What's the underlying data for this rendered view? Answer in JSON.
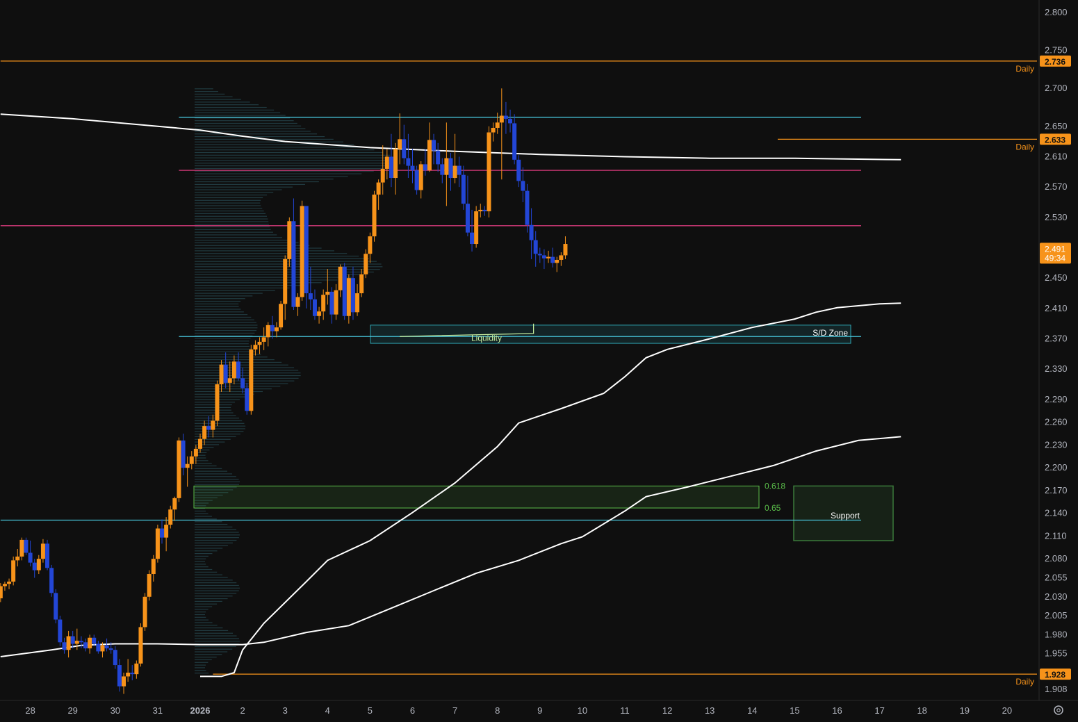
{
  "colors": {
    "background": "#0f0f0f",
    "up": "#f7931a",
    "down": "#2346d6",
    "cyan": "#47c3d9",
    "magenta": "#d63a7a",
    "orange_line": "#f7931a",
    "white_line": "#ffffff",
    "fib_green": "#5bbf4a",
    "support_box": "#3b7a3b",
    "sd_zone": "#2ea3b0",
    "liquidity": "#c9f0a0",
    "axis_text": "#b2b5be"
  },
  "chart_data": {
    "type": "candlestick",
    "title": "",
    "ylim": [
      1.9,
      2.82
    ],
    "y_ticks": [
      "2.800",
      "2.750",
      "2.700",
      "2.650",
      "2.610",
      "2.570",
      "2.530",
      "2.450",
      "2.410",
      "2.370",
      "2.330",
      "2.290",
      "2.260",
      "2.230",
      "2.200",
      "2.170",
      "2.140",
      "2.110",
      "2.080",
      "2.055",
      "2.030",
      "2.005",
      "1.980",
      "1.955",
      "1.908"
    ],
    "x_ticks": [
      "28",
      "29",
      "30",
      "31",
      "2026",
      "2",
      "3",
      "4",
      "5",
      "6",
      "7",
      "8",
      "9",
      "10",
      "11",
      "12",
      "13",
      "14",
      "15",
      "16",
      "17",
      "18",
      "19",
      "20"
    ],
    "price_badges": [
      {
        "value": 2.736,
        "label": "2.736",
        "tag": "Daily"
      },
      {
        "value": 2.633,
        "label": "2.633",
        "tag": "Daily"
      },
      {
        "value": 1.928,
        "label": "1.928",
        "tag": "Daily"
      }
    ],
    "current_price": {
      "value": 2.491,
      "label": "2.491",
      "countdown": "49:34"
    },
    "horizontal_lines": [
      {
        "value": 2.736,
        "color": "orange",
        "start_day": -4.7
      },
      {
        "value": 2.633,
        "color": "orange",
        "start_day": 13.6
      },
      {
        "value": 1.928,
        "color": "orange",
        "start_day": 0.3
      },
      {
        "value": 2.662,
        "color": "cyan",
        "start_day": -0.5
      },
      {
        "value": 2.592,
        "color": "magenta",
        "start_day": -0.5
      },
      {
        "value": 2.519,
        "color": "magenta",
        "start_day": -4.7
      },
      {
        "value": 2.373,
        "color": "cyan",
        "start_day": -0.5
      },
      {
        "value": 2.131,
        "color": "cyan",
        "start_day": -4.7
      }
    ],
    "fib_zone": {
      "top": 2.176,
      "bottom": 2.147,
      "labels": [
        "0.618",
        "0.65"
      ]
    },
    "sd_zone": {
      "top": 2.388,
      "bottom": 2.364,
      "label": "S/D Zone"
    },
    "liquidity": {
      "value": 2.373,
      "label": "Liquidity"
    },
    "support_box": {
      "top": 2.176,
      "bottom": 2.104,
      "label": "Support"
    },
    "moving_averages": [
      {
        "name": "ma_long",
        "points": [
          [
            -4.7,
            2.666
          ],
          [
            -3.0,
            2.66
          ],
          [
            -1.0,
            2.65
          ],
          [
            0,
            2.645
          ],
          [
            1,
            2.637
          ],
          [
            2,
            2.63
          ],
          [
            4,
            2.622
          ],
          [
            6,
            2.617
          ],
          [
            8,
            2.613
          ],
          [
            10,
            2.61
          ],
          [
            12,
            2.608
          ],
          [
            14,
            2.608
          ],
          [
            16.5,
            2.606
          ]
        ]
      },
      {
        "name": "ma_mid",
        "points": [
          [
            -4.7,
            1.951
          ],
          [
            -3.5,
            1.96
          ],
          [
            -2.8,
            1.966
          ],
          [
            -2.0,
            1.968
          ],
          [
            -1.0,
            1.968
          ],
          [
            0,
            1.967
          ],
          [
            1,
            1.967
          ],
          [
            1.5,
            1.97
          ],
          [
            2.5,
            1.983
          ],
          [
            3.5,
            1.992
          ],
          [
            4.5,
            2.015
          ],
          [
            5.5,
            2.038
          ],
          [
            6.5,
            2.061
          ],
          [
            7.5,
            2.078
          ],
          [
            8.5,
            2.1
          ],
          [
            9,
            2.109
          ],
          [
            10,
            2.143
          ],
          [
            10.5,
            2.162
          ],
          [
            11.5,
            2.175
          ],
          [
            12.5,
            2.189
          ],
          [
            13.5,
            2.203
          ],
          [
            14.5,
            2.222
          ],
          [
            15.5,
            2.236
          ],
          [
            16.5,
            2.241
          ]
        ]
      },
      {
        "name": "ma_short",
        "points": [
          [
            0,
            1.925
          ],
          [
            0.5,
            1.925
          ],
          [
            0.8,
            1.93
          ],
          [
            1.0,
            1.96
          ],
          [
            1.5,
            1.995
          ],
          [
            2.5,
            2.05
          ],
          [
            3,
            2.078
          ],
          [
            4,
            2.104
          ],
          [
            5,
            2.141
          ],
          [
            6,
            2.18
          ],
          [
            7,
            2.228
          ],
          [
            7.5,
            2.259
          ],
          [
            8.5,
            2.278
          ],
          [
            9.5,
            2.298
          ],
          [
            10,
            2.32
          ],
          [
            10.5,
            2.345
          ],
          [
            11,
            2.356
          ],
          [
            12,
            2.37
          ],
          [
            13,
            2.385
          ],
          [
            14,
            2.396
          ],
          [
            14.5,
            2.405
          ],
          [
            15,
            2.411
          ],
          [
            16,
            2.416
          ],
          [
            16.5,
            2.417
          ]
        ]
      }
    ],
    "candles": [
      [
        -4.7,
        2.028,
        2.048,
        2.023,
        2.044
      ],
      [
        -4.6,
        2.044,
        2.05,
        2.038,
        2.047
      ],
      [
        -4.5,
        2.047,
        2.054,
        2.04,
        2.05
      ],
      [
        -4.4,
        2.05,
        2.083,
        2.045,
        2.078
      ],
      [
        -4.3,
        2.078,
        2.093,
        2.07,
        2.083
      ],
      [
        -4.2,
        2.083,
        2.108,
        2.078,
        2.105
      ],
      [
        -4.1,
        2.105,
        2.108,
        2.085,
        2.088
      ],
      [
        -4.0,
        2.088,
        2.104,
        2.07,
        2.075
      ],
      [
        -3.9,
        2.075,
        2.08,
        2.055,
        2.065
      ],
      [
        -3.8,
        2.065,
        2.085,
        2.06,
        2.08
      ],
      [
        -3.7,
        2.08,
        2.106,
        2.075,
        2.1
      ],
      [
        -3.6,
        2.1,
        2.105,
        2.065,
        2.068
      ],
      [
        -3.5,
        2.068,
        2.072,
        2.03,
        2.035
      ],
      [
        -3.4,
        2.035,
        2.04,
        1.995,
        2.0
      ],
      [
        -3.3,
        2.0,
        2.005,
        1.965,
        1.97
      ],
      [
        -3.2,
        1.97,
        1.976,
        1.955,
        1.96
      ],
      [
        -3.1,
        1.96,
        1.985,
        1.95,
        1.978
      ],
      [
        -3.0,
        1.978,
        1.985,
        1.962,
        1.968
      ],
      [
        -2.9,
        1.968,
        1.988,
        1.96,
        1.972
      ],
      [
        -2.8,
        1.972,
        1.978,
        1.962,
        1.97
      ],
      [
        -2.7,
        1.97,
        1.975,
        1.958,
        1.962
      ],
      [
        -2.6,
        1.962,
        1.98,
        1.955,
        1.976
      ],
      [
        -2.5,
        1.976,
        1.98,
        1.965,
        1.968
      ],
      [
        -2.4,
        1.968,
        1.972,
        1.955,
        1.958
      ],
      [
        -2.3,
        1.958,
        1.97,
        1.95,
        1.966
      ],
      [
        -2.2,
        1.966,
        1.975,
        1.958,
        1.962
      ],
      [
        -2.1,
        1.962,
        1.97,
        1.955,
        1.96
      ],
      [
        -2.0,
        1.96,
        1.965,
        1.935,
        1.94
      ],
      [
        -1.9,
        1.94,
        1.948,
        1.905,
        1.912
      ],
      [
        -1.8,
        1.912,
        1.93,
        1.902,
        1.925
      ],
      [
        -1.7,
        1.925,
        1.948,
        1.918,
        1.93
      ],
      [
        -1.6,
        1.93,
        1.94,
        1.92,
        1.928
      ],
      [
        -1.5,
        1.928,
        1.946,
        1.922,
        1.942
      ],
      [
        -1.4,
        1.942,
        1.995,
        1.938,
        1.99
      ],
      [
        -1.3,
        1.99,
        2.035,
        1.985,
        2.03
      ],
      [
        -1.2,
        2.03,
        2.065,
        2.025,
        2.06
      ],
      [
        -1.1,
        2.06,
        2.085,
        2.05,
        2.08
      ],
      [
        -1.0,
        2.08,
        2.125,
        2.075,
        2.12
      ],
      [
        -0.9,
        2.12,
        2.132,
        2.1,
        2.108
      ],
      [
        -0.8,
        2.108,
        2.135,
        2.09,
        2.125
      ],
      [
        -0.7,
        2.125,
        2.15,
        2.12,
        2.145
      ],
      [
        -0.6,
        2.145,
        2.162,
        2.13,
        2.16
      ],
      [
        -0.5,
        2.16,
        2.24,
        2.155,
        2.236
      ],
      [
        -0.4,
        2.236,
        2.245,
        2.19,
        2.2
      ],
      [
        -0.3,
        2.2,
        2.215,
        2.175,
        2.205
      ],
      [
        -0.2,
        2.205,
        2.222,
        2.198,
        2.215
      ],
      [
        -0.1,
        2.215,
        2.23,
        2.205,
        2.225
      ],
      [
        0.0,
        2.225,
        2.245,
        2.22,
        2.238
      ],
      [
        0.1,
        2.238,
        2.262,
        2.23,
        2.255
      ],
      [
        0.2,
        2.255,
        2.268,
        2.24,
        2.25
      ],
      [
        0.3,
        2.25,
        2.27,
        2.24,
        2.262
      ],
      [
        0.4,
        2.262,
        2.315,
        2.255,
        2.31
      ],
      [
        0.5,
        2.31,
        2.342,
        2.3,
        2.336
      ],
      [
        0.6,
        2.336,
        2.352,
        2.305,
        2.312
      ],
      [
        0.7,
        2.312,
        2.34,
        2.3,
        2.318
      ],
      [
        0.8,
        2.318,
        2.348,
        2.31,
        2.34
      ],
      [
        0.9,
        2.34,
        2.352,
        2.315,
        2.318
      ],
      [
        1.0,
        2.318,
        2.332,
        2.298,
        2.305
      ],
      [
        1.1,
        2.305,
        2.312,
        2.27,
        2.275
      ],
      [
        1.2,
        2.275,
        2.362,
        2.27,
        2.356
      ],
      [
        1.3,
        2.356,
        2.368,
        2.348,
        2.362
      ],
      [
        1.4,
        2.362,
        2.372,
        2.35,
        2.366
      ],
      [
        1.5,
        2.366,
        2.385,
        2.355,
        2.372
      ],
      [
        1.6,
        2.372,
        2.392,
        2.36,
        2.388
      ],
      [
        1.7,
        2.388,
        2.4,
        2.37,
        2.38
      ],
      [
        1.8,
        2.38,
        2.392,
        2.372,
        2.385
      ],
      [
        1.9,
        2.385,
        2.42,
        2.382,
        2.416
      ],
      [
        2.0,
        2.416,
        2.48,
        2.395,
        2.475
      ],
      [
        2.1,
        2.475,
        2.53,
        2.465,
        2.525
      ],
      [
        2.2,
        2.525,
        2.555,
        2.408,
        2.412
      ],
      [
        2.3,
        2.412,
        2.43,
        2.4,
        2.425
      ],
      [
        2.4,
        2.425,
        2.552,
        2.42,
        2.545
      ],
      [
        2.5,
        2.545,
        2.545,
        2.41,
        2.43
      ],
      [
        2.6,
        2.43,
        2.465,
        2.408,
        2.422
      ],
      [
        2.7,
        2.422,
        2.435,
        2.395,
        2.4
      ],
      [
        2.8,
        2.4,
        2.412,
        2.39,
        2.406
      ],
      [
        2.9,
        2.406,
        2.435,
        2.395,
        2.428
      ],
      [
        3.0,
        2.428,
        2.462,
        2.415,
        2.432
      ],
      [
        3.1,
        2.432,
        2.438,
        2.39,
        2.402
      ],
      [
        3.2,
        2.402,
        2.442,
        2.395,
        2.434
      ],
      [
        3.3,
        2.434,
        2.468,
        2.425,
        2.465
      ],
      [
        3.4,
        2.465,
        2.47,
        2.395,
        2.4
      ],
      [
        3.5,
        2.4,
        2.455,
        2.39,
        2.45
      ],
      [
        3.6,
        2.45,
        2.465,
        2.395,
        2.405
      ],
      [
        3.7,
        2.405,
        2.442,
        2.4,
        2.43
      ],
      [
        3.8,
        2.43,
        2.462,
        2.425,
        2.455
      ],
      [
        3.9,
        2.455,
        2.488,
        2.45,
        2.482
      ],
      [
        4.0,
        2.482,
        2.51,
        2.47,
        2.505
      ],
      [
        4.1,
        2.505,
        2.565,
        2.498,
        2.56
      ],
      [
        4.2,
        2.56,
        2.58,
        2.54,
        2.576
      ],
      [
        4.3,
        2.576,
        2.625,
        2.56,
        2.594
      ],
      [
        4.4,
        2.594,
        2.62,
        2.58,
        2.61
      ],
      [
        4.5,
        2.61,
        2.64,
        2.57,
        2.582
      ],
      [
        4.6,
        2.582,
        2.628,
        2.56,
        2.62
      ],
      [
        4.7,
        2.62,
        2.667,
        2.6,
        2.633
      ],
      [
        4.8,
        2.633,
        2.652,
        2.6,
        2.608
      ],
      [
        4.9,
        2.608,
        2.64,
        2.582,
        2.598
      ],
      [
        5.0,
        2.598,
        2.62,
        2.575,
        2.592
      ],
      [
        5.1,
        2.592,
        2.598,
        2.56,
        2.566
      ],
      [
        5.2,
        2.566,
        2.604,
        2.555,
        2.6
      ],
      [
        5.3,
        2.6,
        2.62,
        2.585,
        2.592
      ],
      [
        5.4,
        2.592,
        2.655,
        2.59,
        2.632
      ],
      [
        5.5,
        2.632,
        2.64,
        2.6,
        2.618
      ],
      [
        5.6,
        2.618,
        2.628,
        2.59,
        2.6
      ],
      [
        5.7,
        2.6,
        2.608,
        2.575,
        2.586
      ],
      [
        5.8,
        2.586,
        2.655,
        2.545,
        2.608
      ],
      [
        5.9,
        2.608,
        2.615,
        2.565,
        2.582
      ],
      [
        6.0,
        2.582,
        2.64,
        2.575,
        2.598
      ],
      [
        6.1,
        2.598,
        2.61,
        2.57,
        2.586
      ],
      [
        6.2,
        2.586,
        2.598,
        2.54,
        2.548
      ],
      [
        6.3,
        2.548,
        2.585,
        2.505,
        2.51
      ],
      [
        6.4,
        2.51,
        2.54,
        2.485,
        2.495
      ],
      [
        6.5,
        2.495,
        2.545,
        2.49,
        2.538
      ],
      [
        6.6,
        2.538,
        2.548,
        2.53,
        2.54
      ],
      [
        6.7,
        2.54,
        2.545,
        2.532,
        2.538
      ],
      [
        6.8,
        2.538,
        2.65,
        2.53,
        2.642
      ],
      [
        6.9,
        2.642,
        2.655,
        2.63,
        2.648
      ],
      [
        7.0,
        2.648,
        2.668,
        2.64,
        2.655
      ],
      [
        7.1,
        2.655,
        2.7,
        2.58,
        2.664
      ],
      [
        7.2,
        2.664,
        2.682,
        2.64,
        2.66
      ],
      [
        7.3,
        2.66,
        2.672,
        2.642,
        2.654
      ],
      [
        7.4,
        2.654,
        2.666,
        2.6,
        2.606
      ],
      [
        7.5,
        2.606,
        2.612,
        2.57,
        2.578
      ],
      [
        7.6,
        2.578,
        2.596,
        2.55,
        2.565
      ],
      [
        7.7,
        2.565,
        2.574,
        2.51,
        2.52
      ],
      [
        7.8,
        2.52,
        2.542,
        2.475,
        2.5
      ],
      [
        7.9,
        2.5,
        2.512,
        2.465,
        2.482
      ],
      [
        8.0,
        2.482,
        2.49,
        2.47,
        2.48
      ],
      [
        8.1,
        2.48,
        2.488,
        2.462,
        2.476
      ],
      [
        8.2,
        2.476,
        2.486,
        2.47,
        2.478
      ],
      [
        8.3,
        2.478,
        2.49,
        2.464,
        2.47
      ],
      [
        8.4,
        2.47,
        2.478,
        2.458,
        2.474
      ],
      [
        8.5,
        2.474,
        2.484,
        2.466,
        2.48
      ],
      [
        8.6,
        2.48,
        2.505,
        2.475,
        2.495
      ]
    ]
  },
  "axis": {
    "settings_icon": "gear-icon"
  }
}
